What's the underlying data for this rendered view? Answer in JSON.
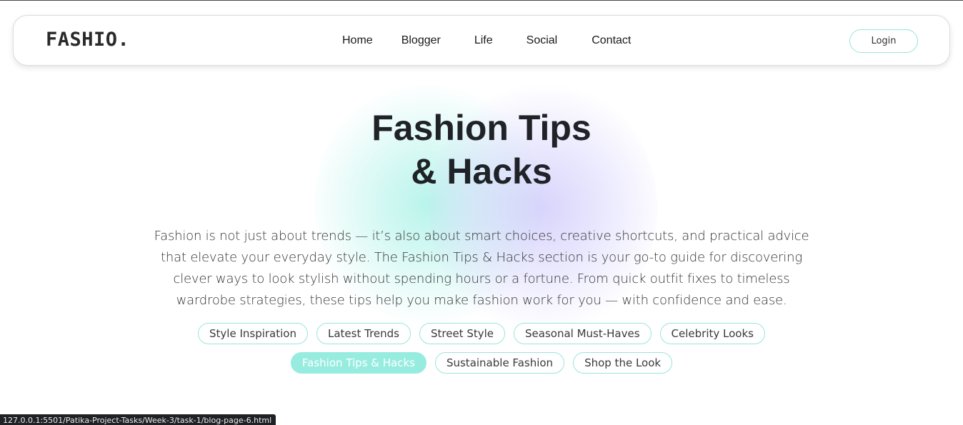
{
  "header": {
    "logo": "FASHIO.",
    "nav": [
      "Home",
      "Blogger",
      "Life",
      "Social",
      "Contact"
    ],
    "login_label": "Login"
  },
  "hero": {
    "title_line1": "Fashion Tips",
    "title_line2": "& Hacks",
    "description": "Fashion is not just about trends — it’s also about smart choices, creative shortcuts, and practical advice that elevate your everyday style. The Fashion Tips & Hacks section is your go-to guide for discovering clever ways to look stylish without spending hours or a fortune. From quick outfit fixes to timeless wardrobe strategies, these tips help you make fashion work for you — with confidence and ease."
  },
  "tags": [
    {
      "label": "Style Inspiration",
      "active": false
    },
    {
      "label": "Latest Trends",
      "active": false
    },
    {
      "label": "Street Style",
      "active": false
    },
    {
      "label": "Seasonal Must-Haves",
      "active": false
    },
    {
      "label": "Celebrity Looks",
      "active": false
    },
    {
      "label": "Fashion Tips & Hacks",
      "active": true
    },
    {
      "label": "Sustainable Fashion",
      "active": false
    },
    {
      "label": "Shop the Look",
      "active": false
    }
  ],
  "status_bar": {
    "url": "127.0.0.1:5501/Patika-Project-Tasks/Week-3/task-1/blog-page-6.html"
  },
  "colors": {
    "accent_mint": "#97ece0",
    "border_mint": "#97e6db",
    "text_dark": "#1f2226"
  }
}
